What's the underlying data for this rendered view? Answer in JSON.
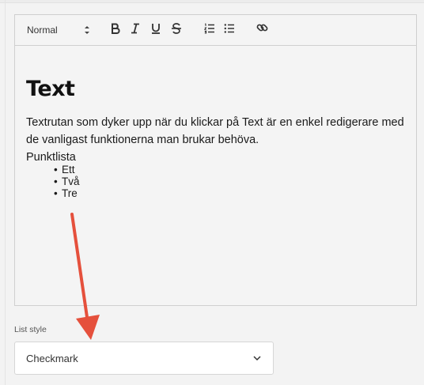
{
  "toolbar": {
    "format_label": "Normal",
    "icons": [
      "bold-icon",
      "italic-icon",
      "underline-icon",
      "strikethrough-icon",
      "ordered-list-icon",
      "bullet-list-icon",
      "link-icon"
    ]
  },
  "editor": {
    "heading": "Text",
    "paragraph": "Textrutan som dyker upp när du klickar på Text är en enkel redigerare med de vanligast funktionerna man brukar behöva.",
    "list_title": "Punktlista",
    "list_items": [
      "Ett",
      "Två",
      "Tre"
    ]
  },
  "list_style": {
    "label": "List style",
    "value": "Checkmark"
  },
  "colors": {
    "annotation_arrow": "#e5503c"
  }
}
